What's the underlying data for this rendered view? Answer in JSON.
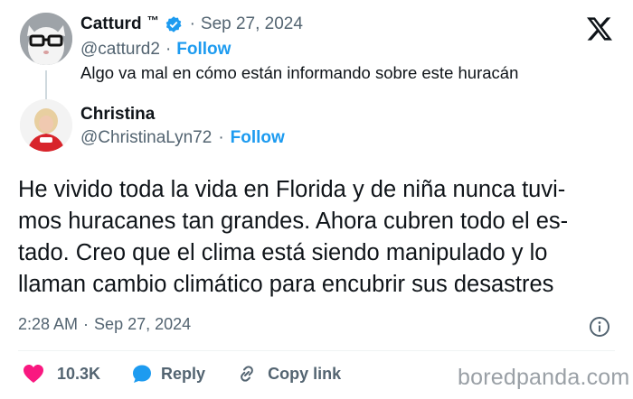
{
  "quote_tweet": {
    "author_name": "Catturd",
    "trademark": "™",
    "dot": "·",
    "date": "Sep 27, 2024",
    "handle": "@catturd2",
    "follow_label": "Follow",
    "text": "Algo va mal en cómo están informando sobre este huracán"
  },
  "main_tweet": {
    "author_name": "Christina",
    "handle": "@ChristinaLyn72",
    "dot": "·",
    "follow_label": "Follow",
    "text_lines": [
      "He vivido toda la vida en Florida y de niña nunca tuvi-",
      "mos huracanes tan grandes. Ahora cubren todo el es-",
      "tado. Creo que el clima está siendo manipulado y lo",
      "llaman cambio climático para encubrir sus desastres"
    ],
    "time": "2:28 AM",
    "date": "Sep 27, 2024"
  },
  "actions": {
    "likes": "10.3K",
    "reply_label": "Reply",
    "copy_link_label": "Copy link"
  },
  "watermark": "boredpanda.com",
  "colors": {
    "accent_blue": "#1d9bf0",
    "like_pink": "#f91880",
    "muted_gray": "#536471"
  },
  "icons": [
    "x-logo-icon",
    "verified-badge-icon",
    "info-icon",
    "heart-icon",
    "reply-icon",
    "link-icon"
  ]
}
